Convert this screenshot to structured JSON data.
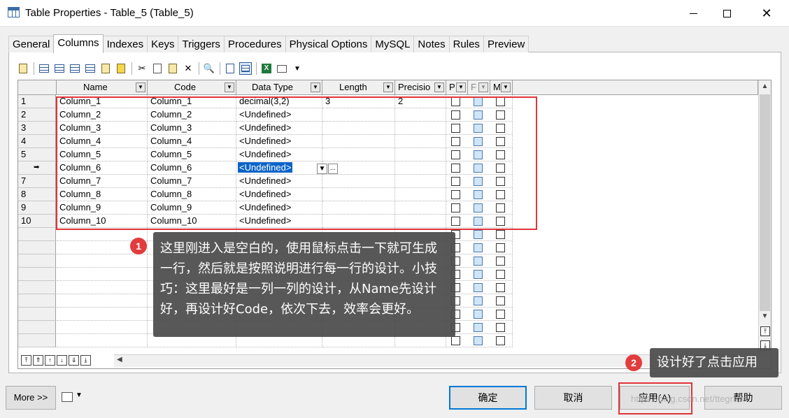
{
  "window": {
    "title": "Table Properties - Table_5 (Table_5)",
    "close_glyph": "✕"
  },
  "tabs": [
    "General",
    "Columns",
    "Indexes",
    "Keys",
    "Triggers",
    "Procedures",
    "Physical Options",
    "MySQL",
    "Notes",
    "Rules",
    "Preview"
  ],
  "active_tab": "Columns",
  "toolbar": {
    "icons": [
      "properties-icon",
      "insert-row-icon",
      "add-row-icon",
      "add-columns-icon",
      "add-columns-2-icon",
      "paste-icon",
      "wizard-icon",
      "cut-icon",
      "copy-icon",
      "paste-icon-2",
      "delete-icon",
      "find-icon",
      "filter-icon",
      "customize-columns-icon",
      "excel-export-icon",
      "print-icon",
      "dropdown-icon"
    ],
    "glyphs": {
      "cut": "✂",
      "delete": "✕",
      "find": "🔍",
      "excel": "X",
      "dropdown": "▼"
    }
  },
  "grid": {
    "columns": [
      "Name",
      "Code",
      "Data Type",
      "Length",
      "Precisio",
      "P",
      "F",
      "M"
    ],
    "dropdown_glyph": "▼",
    "current_row_marker": "➡",
    "rows": [
      {
        "num": "1",
        "name": "Column_1",
        "code": "Column_1",
        "data_type": "decimal(3,2)",
        "length": "3",
        "precision": "2"
      },
      {
        "num": "2",
        "name": "Column_2",
        "code": "Column_2",
        "data_type": "<Undefined>",
        "length": "",
        "precision": ""
      },
      {
        "num": "3",
        "name": "Column_3",
        "code": "Column_3",
        "data_type": "<Undefined>",
        "length": "",
        "precision": ""
      },
      {
        "num": "4",
        "name": "Column_4",
        "code": "Column_4",
        "data_type": "<Undefined>",
        "length": "",
        "precision": ""
      },
      {
        "num": "5",
        "name": "Column_5",
        "code": "Column_5",
        "data_type": "<Undefined>",
        "length": "",
        "precision": ""
      },
      {
        "num": "",
        "name": "Column_6",
        "code": "Column_6",
        "data_type": "<Undefined>",
        "length": "",
        "precision": ""
      },
      {
        "num": "7",
        "name": "Column_7",
        "code": "Column_7",
        "data_type": "<Undefined>",
        "length": "",
        "precision": ""
      },
      {
        "num": "8",
        "name": "Column_8",
        "code": "Column_8",
        "data_type": "<Undefined>",
        "length": "",
        "precision": ""
      },
      {
        "num": "9",
        "name": "Column_9",
        "code": "Column_9",
        "data_type": "<Undefined>",
        "length": "",
        "precision": ""
      },
      {
        "num": "10",
        "name": "Column_10",
        "code": "Column_10",
        "data_type": "<Undefined>",
        "length": "",
        "precision": ""
      }
    ],
    "nav_glyphs": [
      "⤒",
      "⇑",
      "↑",
      "↓",
      "⇓",
      "⤓"
    ],
    "scroll_glyphs": {
      "up": "▲",
      "down": "▼",
      "left": "◀",
      "top": "⤒",
      "bottom": "⤓"
    }
  },
  "annotations": {
    "callout1": {
      "badge": "1",
      "text": "这里刚进入是空白的，使用鼠标点击一下就可生成一行，然后就是按照说明进行每一行的设计。小技巧：这里最好是一列一列的设计，从Name先设计好，再设计好Code，依次下去，效率会更好。"
    },
    "callout2": {
      "badge": "2",
      "text": "设计好了点击应用"
    }
  },
  "buttons": {
    "more": "More >>",
    "ok": "确定",
    "cancel": "取消",
    "apply": "应用(A)",
    "help": "帮助",
    "print_dropdown": "▼"
  },
  "watermark": "https://blog.csdn.net/ttegrass",
  "colors": {
    "highlight_red": "#e0343a",
    "selection_blue": "#0a64c8",
    "badge_red": "#e23c3c",
    "foreign_key_checkbox": "#cfe6fa"
  }
}
